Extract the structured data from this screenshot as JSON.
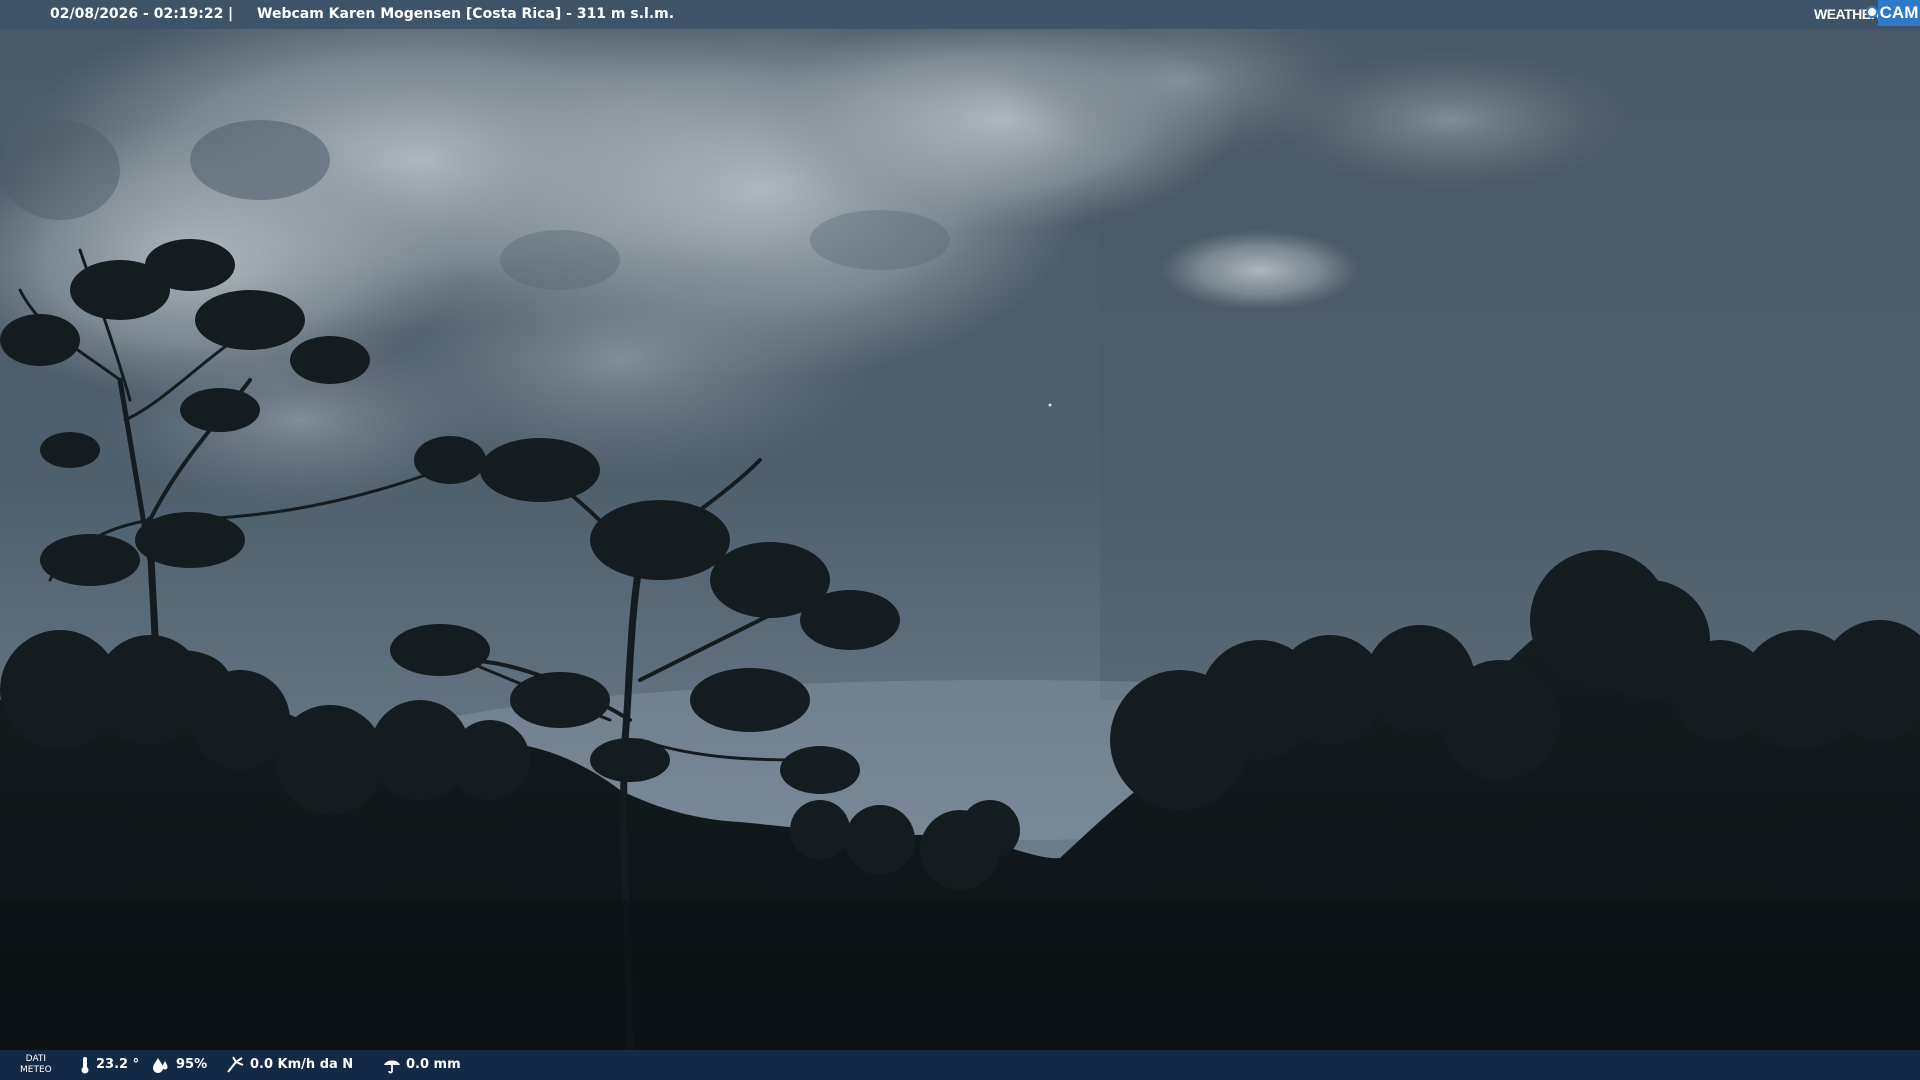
{
  "overlay": {
    "datetime": "02/08/2026 - 02:19:22",
    "separator": "|",
    "location": "Webcam Karen Mogensen [Costa Rica]  - 311 m s.l.m.",
    "logo_weather": "WEATHER",
    "logo_cam": "CAM",
    "colors": {
      "bar_top": "#3e5268",
      "bar_bottom": "#142c4a",
      "logo_blue": "#2f79c7"
    }
  },
  "weather": {
    "label_line1": "DATI",
    "label_line2": "METEO",
    "temperature": "23.2 °",
    "humidity": "95%",
    "wind": "0.0 Km/h da N",
    "rain": "0.0 mm",
    "icons": [
      "thermometer-icon",
      "humidity-icon",
      "wind-icon",
      "rain-icon"
    ]
  }
}
